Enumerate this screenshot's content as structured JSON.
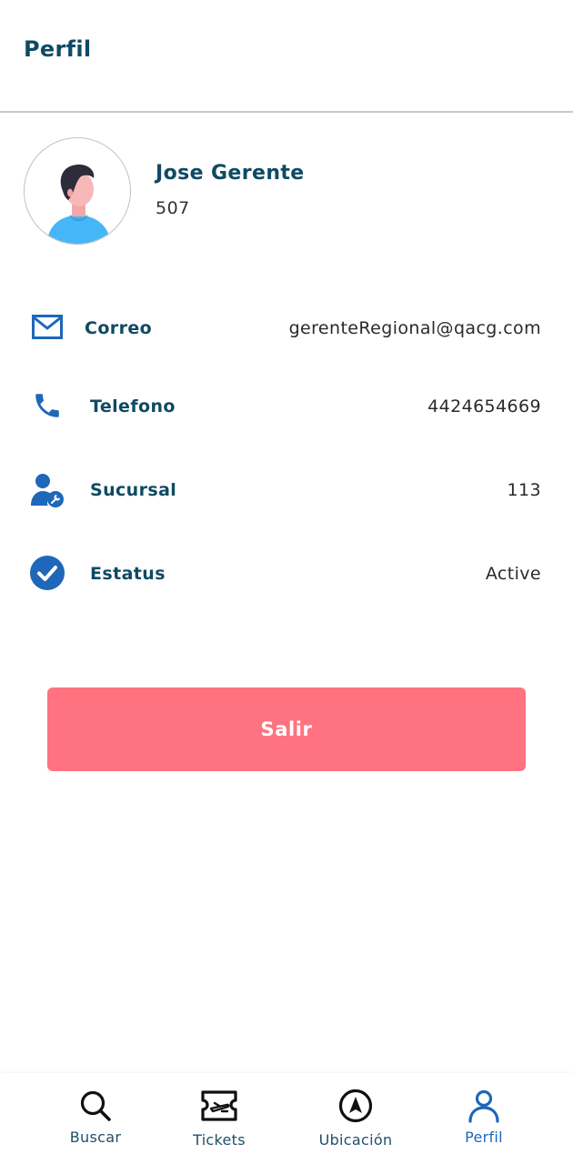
{
  "header": {
    "title": "Perfil"
  },
  "profile": {
    "name": "Jose Gerente",
    "id": "507"
  },
  "info": [
    {
      "icon": "envelope-icon",
      "label": "Correo",
      "value": "gerenteRegional@qacg.com"
    },
    {
      "icon": "phone-icon",
      "label": "Telefono",
      "value": "4424654669"
    },
    {
      "icon": "user-wrench-icon",
      "label": "Sucursal",
      "value": "113"
    },
    {
      "icon": "check-circle-icon",
      "label": "Estatus",
      "value": "Active"
    }
  ],
  "logout": {
    "label": "Salir"
  },
  "bottom_nav": {
    "items": [
      {
        "icon": "search-icon",
        "label": "Buscar",
        "active": false
      },
      {
        "icon": "ticket-icon",
        "label": "Tickets",
        "active": false
      },
      {
        "icon": "navigation-icon",
        "label": "Ubicación",
        "active": false
      },
      {
        "icon": "person-icon",
        "label": "Perfil",
        "active": true
      }
    ]
  },
  "colors": {
    "primary_text": "#0f4a63",
    "icon_blue": "#1e67b9",
    "logout_button": "#ff7280",
    "avatar_shirt": "#45b6f7"
  }
}
